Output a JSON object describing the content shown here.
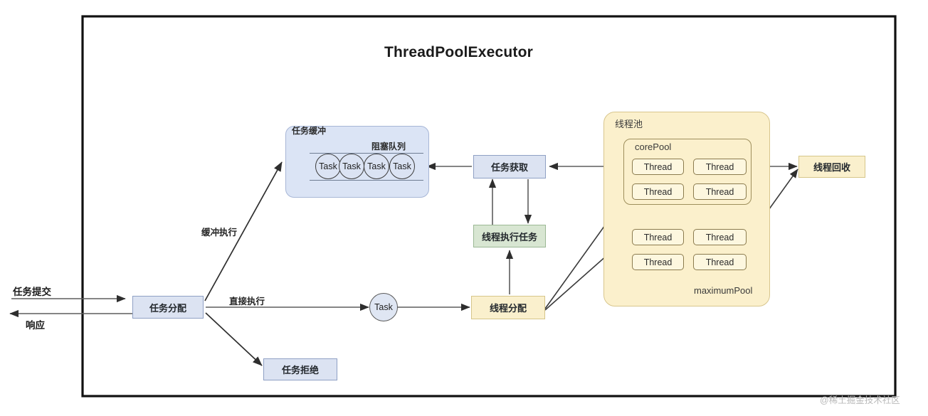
{
  "diagram": {
    "title": "ThreadPoolExecutor",
    "watermark": "@稀土掘金技术社区"
  },
  "io": {
    "submit_label": "任务提交",
    "response_label": "响应"
  },
  "nodes": {
    "task_dispatch": "任务分配",
    "task_reject": "任务拒绝",
    "task_fetch": "任务获取",
    "thread_run_task": "线程执行任务",
    "thread_dispatch": "线程分配",
    "thread_recycle": "线程回收",
    "task_circle": "Task"
  },
  "edge_labels": {
    "buffered_exec": "缓冲执行",
    "direct_exec": "直接执行"
  },
  "buffer_panel": {
    "title": "任务缓冲",
    "queue_title": "阻塞队列",
    "queue_tasks": [
      "Task",
      "Task",
      "Task",
      "Task"
    ]
  },
  "pool_panel": {
    "title": "线程池",
    "core_pool_label": "corePool",
    "maximum_pool_label": "maximumPool",
    "core_threads": [
      "Thread",
      "Thread",
      "Thread",
      "Thread"
    ],
    "extra_threads": [
      "Thread",
      "Thread",
      "Thread",
      "Thread"
    ]
  },
  "colors": {
    "blue_fill": "#dce3f2",
    "blue_stroke": "#8fa0c4",
    "green_fill": "#d8e6d2",
    "green_stroke": "#9bb894",
    "yellow_fill": "#faf0cd",
    "yellow_stroke": "#d6c68a",
    "panel_blue": "#dbe4f5",
    "panel_yellow": "#fbf0cc",
    "arrow": "#5d5d5d",
    "arrow_dark": "#3a3a3a",
    "border": "#111111"
  }
}
